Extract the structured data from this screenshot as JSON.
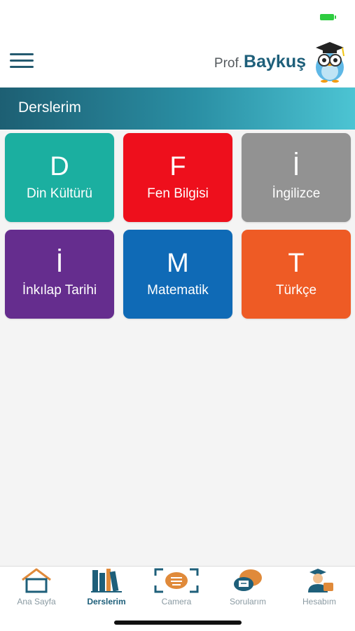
{
  "app": {
    "brand_prefix": "Prof.",
    "brand_name": "Baykuş",
    "logo_icon": "owl-mascot-icon"
  },
  "status_bar": {
    "battery_color": "#2ecc40"
  },
  "header": {
    "menu_icon": "hamburger-menu-icon"
  },
  "page": {
    "title": "Derslerim"
  },
  "courses": [
    {
      "letter": "D",
      "name": "Din Kültürü",
      "color": "#1bafa0"
    },
    {
      "letter": "F",
      "name": "Fen Bilgisi",
      "color": "#ee0f1c"
    },
    {
      "letter": "İ",
      "name": "İngilizce",
      "color": "#929292"
    },
    {
      "letter": "İ",
      "name": "İnkılap Tarihi",
      "color": "#652d8e"
    },
    {
      "letter": "M",
      "name": "Matematik",
      "color": "#0f6ab6"
    },
    {
      "letter": "T",
      "name": "Türkçe",
      "color": "#ee5b25"
    }
  ],
  "bottom_nav": [
    {
      "label": "Ana Sayfa",
      "icon": "house-icon",
      "active": false
    },
    {
      "label": "Derslerim",
      "icon": "books-icon",
      "active": true
    },
    {
      "label": "Camera",
      "icon": "camera-icon",
      "active": false
    },
    {
      "label": "Sorularım",
      "icon": "chat-questions-icon",
      "active": false
    },
    {
      "label": "Hesabım",
      "icon": "graduate-user-icon",
      "active": false
    }
  ]
}
